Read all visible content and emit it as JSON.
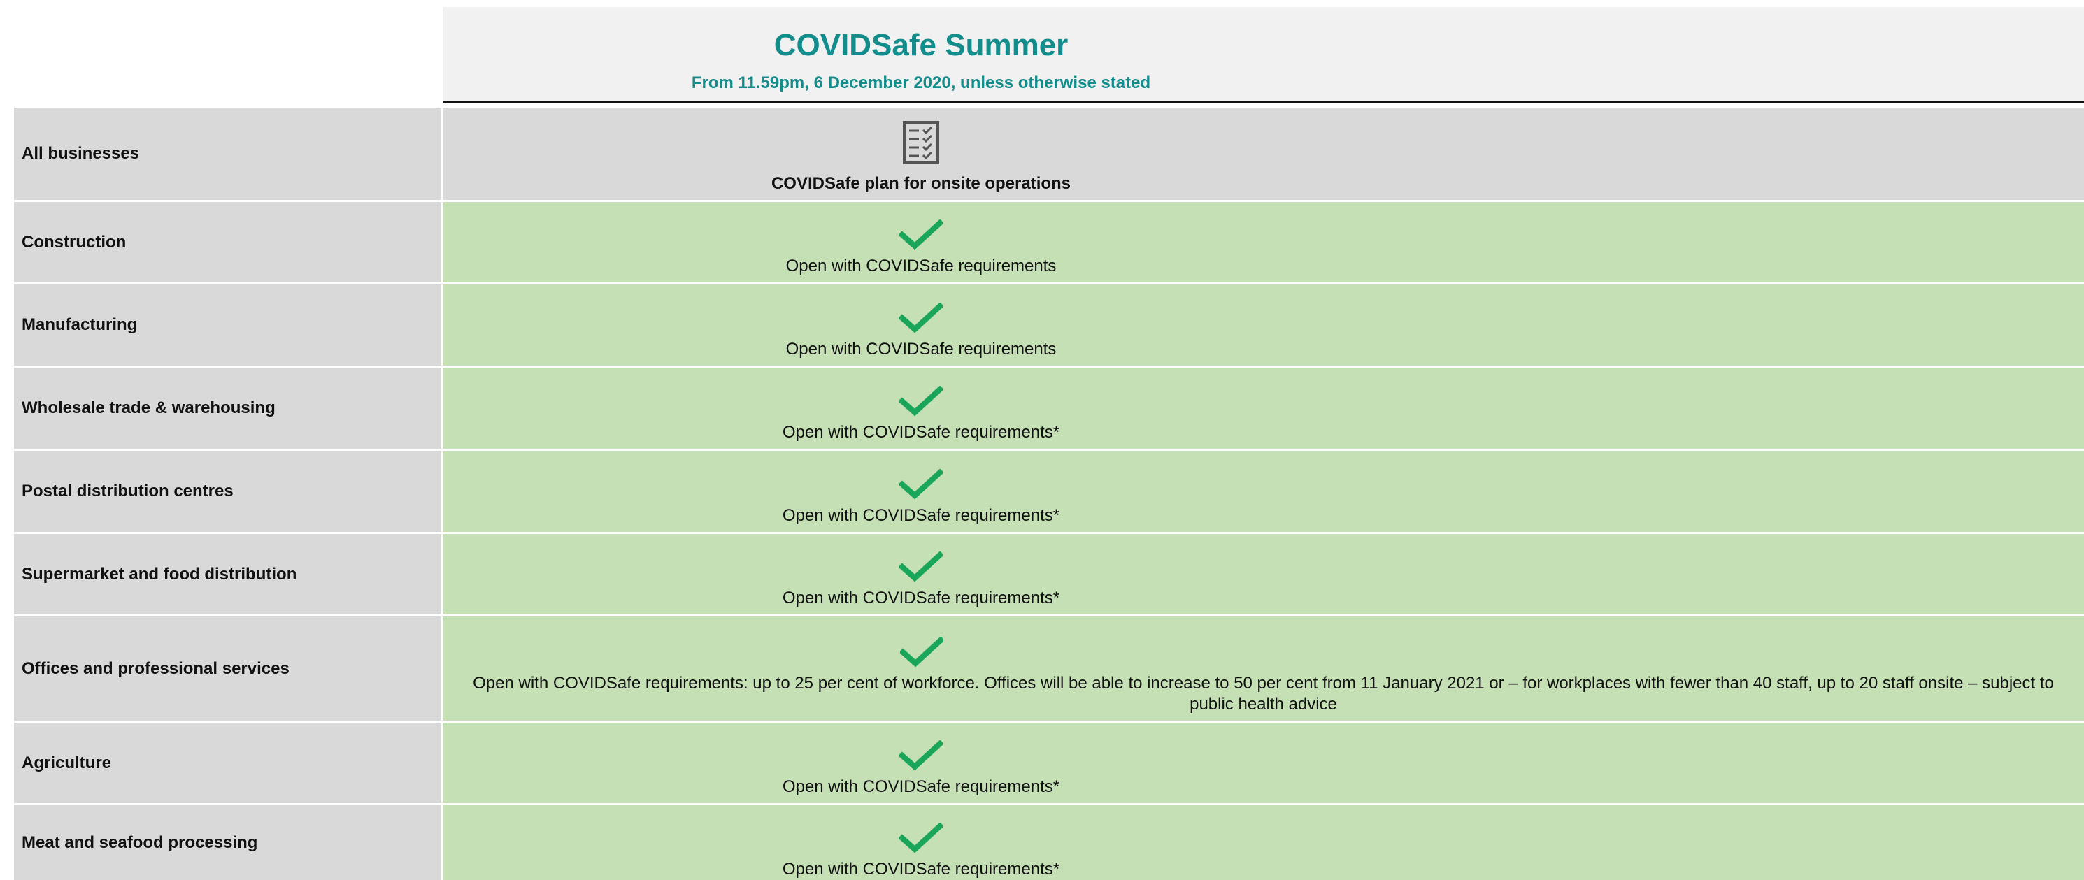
{
  "header": {
    "title": "COVIDSafe Summer",
    "subtitle": "From 11.59pm, 6 December 2020, unless otherwise stated"
  },
  "colors": {
    "accent": "#138c8c",
    "open_green": "#c5e0b4",
    "check_green": "#1aa65a",
    "label_grey": "#d9d9d9"
  },
  "rows": [
    {
      "label": "All businesses",
      "icon": "checklist-icon",
      "status": "COVIDSafe plan for onsite operations"
    },
    {
      "label": "Construction",
      "icon": "check-icon",
      "status": "Open with COVIDSafe requirements"
    },
    {
      "label": "Manufacturing",
      "icon": "check-icon",
      "status": "Open with COVIDSafe requirements"
    },
    {
      "label": "Wholesale trade & warehousing",
      "icon": "check-icon",
      "status": "Open with COVIDSafe requirements*"
    },
    {
      "label": "Postal distribution centres",
      "icon": "check-icon",
      "status": "Open with COVIDSafe requirements*"
    },
    {
      "label": "Supermarket and food distribution",
      "icon": "check-icon",
      "status": "Open with COVIDSafe requirements*"
    },
    {
      "label": "Offices and professional services",
      "icon": "check-icon",
      "status": "Open with COVIDSafe requirements: up to 25 per cent of workforce. Offices will be able to increase to 50 per cent from 11 January 2021 or – for workplaces with fewer than 40 staff, up to 20 staff onsite – subject to public health advice"
    },
    {
      "label": "Agriculture",
      "icon": "check-icon",
      "status": "Open with COVIDSafe requirements*"
    },
    {
      "label": "Meat and seafood processing",
      "icon": "check-icon",
      "status": "Open with COVIDSafe requirements*"
    }
  ]
}
